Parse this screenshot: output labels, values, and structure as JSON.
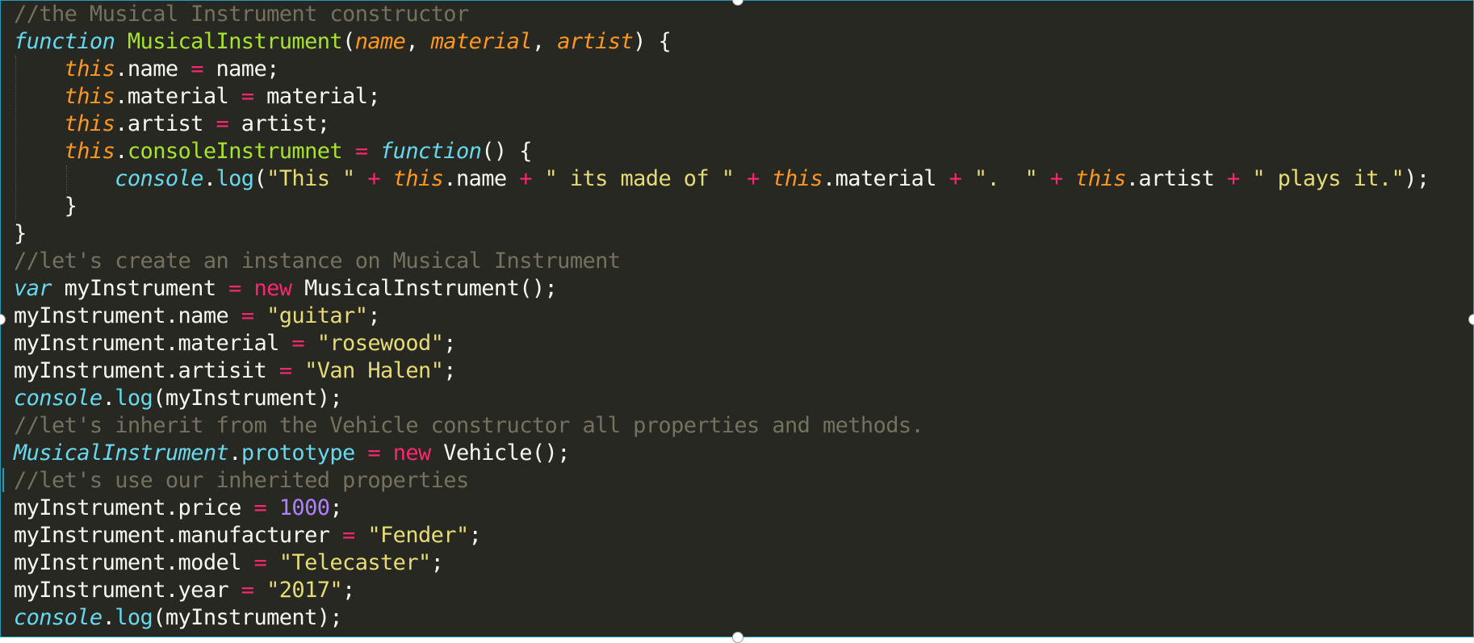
{
  "editor": {
    "theme": "monokai",
    "colors": {
      "background": "#272822",
      "comment": "#75715e",
      "keyword": "#66d9ef",
      "function_name": "#a6e22e",
      "parameter": "#fd971f",
      "operator": "#f92672",
      "string": "#e6db74",
      "number": "#ae81ff",
      "plain": "#f8f8f2",
      "selection_border": "#1f9dbd"
    },
    "lines": [
      [
        {
          "t": "//the Musical Instrument constructor",
          "c": "comment"
        }
      ],
      [
        {
          "t": "function",
          "c": "kw-storage"
        },
        {
          "t": " ",
          "c": "plain"
        },
        {
          "t": "MusicalInstrument",
          "c": "fn-name"
        },
        {
          "t": "(",
          "c": "plain"
        },
        {
          "t": "name",
          "c": "param"
        },
        {
          "t": ", ",
          "c": "plain"
        },
        {
          "t": "material",
          "c": "param"
        },
        {
          "t": ", ",
          "c": "plain"
        },
        {
          "t": "artist",
          "c": "param"
        },
        {
          "t": ") {",
          "c": "plain"
        }
      ],
      [
        {
          "t": "    ",
          "c": "plain"
        },
        {
          "t": "this",
          "c": "this"
        },
        {
          "t": ".name ",
          "c": "plain"
        },
        {
          "t": "=",
          "c": "op"
        },
        {
          "t": " name;",
          "c": "plain"
        }
      ],
      [
        {
          "t": "    ",
          "c": "plain"
        },
        {
          "t": "this",
          "c": "this"
        },
        {
          "t": ".material ",
          "c": "plain"
        },
        {
          "t": "=",
          "c": "op"
        },
        {
          "t": " material;",
          "c": "plain"
        }
      ],
      [
        {
          "t": "    ",
          "c": "plain"
        },
        {
          "t": "this",
          "c": "this"
        },
        {
          "t": ".artist ",
          "c": "plain"
        },
        {
          "t": "=",
          "c": "op"
        },
        {
          "t": " artist;",
          "c": "plain"
        }
      ],
      [
        {
          "t": "    ",
          "c": "plain"
        },
        {
          "t": "this",
          "c": "this"
        },
        {
          "t": ".",
          "c": "plain"
        },
        {
          "t": "consoleInstrumnet",
          "c": "fn-name"
        },
        {
          "t": " ",
          "c": "plain"
        },
        {
          "t": "=",
          "c": "op"
        },
        {
          "t": " ",
          "c": "plain"
        },
        {
          "t": "function",
          "c": "kw-storage"
        },
        {
          "t": "() {",
          "c": "plain"
        }
      ],
      [
        {
          "t": "        ",
          "c": "plain"
        },
        {
          "t": "console",
          "c": "builtin"
        },
        {
          "t": ".",
          "c": "plain"
        },
        {
          "t": "log",
          "c": "method"
        },
        {
          "t": "(",
          "c": "plain"
        },
        {
          "t": "\"This \"",
          "c": "str"
        },
        {
          "t": " ",
          "c": "plain"
        },
        {
          "t": "+",
          "c": "op"
        },
        {
          "t": " ",
          "c": "plain"
        },
        {
          "t": "this",
          "c": "this"
        },
        {
          "t": ".name ",
          "c": "plain"
        },
        {
          "t": "+",
          "c": "op"
        },
        {
          "t": " ",
          "c": "plain"
        },
        {
          "t": "\" its made of \"",
          "c": "str"
        },
        {
          "t": " ",
          "c": "plain"
        },
        {
          "t": "+",
          "c": "op"
        },
        {
          "t": " ",
          "c": "plain"
        },
        {
          "t": "this",
          "c": "this"
        },
        {
          "t": ".material ",
          "c": "plain"
        },
        {
          "t": "+",
          "c": "op"
        },
        {
          "t": " ",
          "c": "plain"
        },
        {
          "t": "\".  \"",
          "c": "str"
        },
        {
          "t": " ",
          "c": "plain"
        },
        {
          "t": "+",
          "c": "op"
        },
        {
          "t": " ",
          "c": "plain"
        },
        {
          "t": "this",
          "c": "this"
        },
        {
          "t": ".artist ",
          "c": "plain"
        },
        {
          "t": "+",
          "c": "op"
        },
        {
          "t": " ",
          "c": "plain"
        },
        {
          "t": "\" plays it.\"",
          "c": "str"
        },
        {
          "t": ");",
          "c": "plain"
        }
      ],
      [
        {
          "t": "    }",
          "c": "plain"
        }
      ],
      [
        {
          "t": "}",
          "c": "plain"
        }
      ],
      [
        {
          "t": "//let's create an instance on Musical Instrument",
          "c": "comment"
        }
      ],
      [
        {
          "t": "var",
          "c": "kw-storage"
        },
        {
          "t": " myInstrument ",
          "c": "plain"
        },
        {
          "t": "=",
          "c": "op"
        },
        {
          "t": " ",
          "c": "plain"
        },
        {
          "t": "new",
          "c": "op"
        },
        {
          "t": " MusicalInstrument();",
          "c": "plain"
        }
      ],
      [
        {
          "t": "myInstrument.name ",
          "c": "plain"
        },
        {
          "t": "=",
          "c": "op"
        },
        {
          "t": " ",
          "c": "plain"
        },
        {
          "t": "\"guitar\"",
          "c": "str"
        },
        {
          "t": ";",
          "c": "plain"
        }
      ],
      [
        {
          "t": "myInstrument.material ",
          "c": "plain"
        },
        {
          "t": "=",
          "c": "op"
        },
        {
          "t": " ",
          "c": "plain"
        },
        {
          "t": "\"rosewood\"",
          "c": "str"
        },
        {
          "t": ";",
          "c": "plain"
        }
      ],
      [
        {
          "t": "myInstrument.artisit ",
          "c": "plain"
        },
        {
          "t": "=",
          "c": "op"
        },
        {
          "t": " ",
          "c": "plain"
        },
        {
          "t": "\"Van Halen\"",
          "c": "str"
        },
        {
          "t": ";",
          "c": "plain"
        }
      ],
      [
        {
          "t": "console",
          "c": "builtin"
        },
        {
          "t": ".",
          "c": "plain"
        },
        {
          "t": "log",
          "c": "method"
        },
        {
          "t": "(myInstrument);",
          "c": "plain"
        }
      ],
      [
        {
          "t": "//let's inherit from the Vehicle constructor all properties and methods.",
          "c": "comment"
        }
      ],
      [
        {
          "t": "MusicalInstrument",
          "c": "class-italic"
        },
        {
          "t": ".",
          "c": "plain"
        },
        {
          "t": "prototype",
          "c": "method"
        },
        {
          "t": " ",
          "c": "plain"
        },
        {
          "t": "=",
          "c": "op"
        },
        {
          "t": " ",
          "c": "plain"
        },
        {
          "t": "new",
          "c": "op"
        },
        {
          "t": " Vehicle();",
          "c": "plain"
        }
      ],
      [
        {
          "t": "//let's use our inherited properties",
          "c": "comment"
        }
      ],
      [
        {
          "t": "myInstrument.price ",
          "c": "plain"
        },
        {
          "t": "=",
          "c": "op"
        },
        {
          "t": " ",
          "c": "plain"
        },
        {
          "t": "1000",
          "c": "num"
        },
        {
          "t": ";",
          "c": "plain"
        }
      ],
      [
        {
          "t": "myInstrument.manufacturer ",
          "c": "plain"
        },
        {
          "t": "=",
          "c": "op"
        },
        {
          "t": " ",
          "c": "plain"
        },
        {
          "t": "\"Fender\"",
          "c": "str"
        },
        {
          "t": ";",
          "c": "plain"
        }
      ],
      [
        {
          "t": "myInstrument.model ",
          "c": "plain"
        },
        {
          "t": "=",
          "c": "op"
        },
        {
          "t": " ",
          "c": "plain"
        },
        {
          "t": "\"Telecaster\"",
          "c": "str"
        },
        {
          "t": ";",
          "c": "plain"
        }
      ],
      [
        {
          "t": "myInstrument.year ",
          "c": "plain"
        },
        {
          "t": "=",
          "c": "op"
        },
        {
          "t": " ",
          "c": "plain"
        },
        {
          "t": "\"2017\"",
          "c": "str"
        },
        {
          "t": ";",
          "c": "plain"
        }
      ],
      [
        {
          "t": "console",
          "c": "builtin"
        },
        {
          "t": ".",
          "c": "plain"
        },
        {
          "t": "log",
          "c": "method"
        },
        {
          "t": "(myInstrument);",
          "c": "plain"
        }
      ]
    ]
  }
}
